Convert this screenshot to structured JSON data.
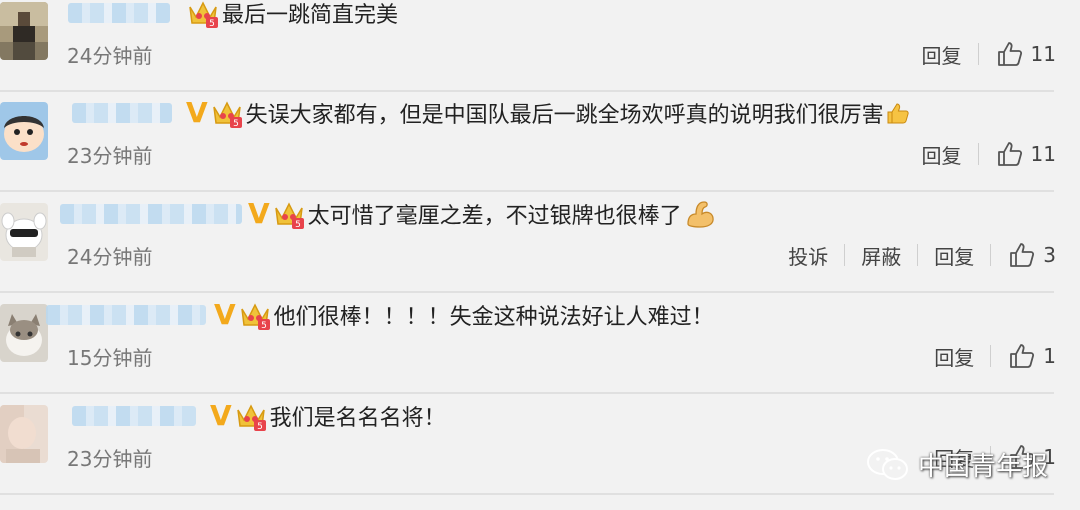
{
  "comments": [
    {
      "text": "最后一跳简直完美",
      "time": "24分钟前",
      "actions": [
        "回复"
      ],
      "likes": "11",
      "vip": "",
      "emoji": ""
    },
    {
      "text": "失误大家都有，但是中国队最后一跳全场欢呼真的说明我们很厉害",
      "time": "23分钟前",
      "actions": [
        "回复"
      ],
      "likes": "11",
      "vip": "V",
      "emoji": "thumbs-up"
    },
    {
      "text": "太可惜了毫厘之差，不过银牌也很棒了",
      "time": "24分钟前",
      "actions": [
        "投诉",
        "屏蔽",
        "回复"
      ],
      "likes": "3",
      "vip": "V",
      "emoji": "flexed-biceps"
    },
    {
      "text": "他们很棒！！！！失金这种说法好让人难过！",
      "time": "15分钟前",
      "actions": [
        "回复"
      ],
      "likes": "1",
      "vip": "V",
      "emoji": ""
    },
    {
      "text": "我们是名名名将！",
      "time": "23分钟前",
      "actions": [
        "回复"
      ],
      "likes": "1",
      "vip": "V",
      "emoji": ""
    }
  ],
  "watermark": {
    "text": "中国青年报",
    "icon": "wechat-icon"
  },
  "colors": {
    "background": "#f2f2f2",
    "vip": "#f3a91c",
    "crown": "#f0c23a",
    "separator": "#e0e0e0"
  }
}
